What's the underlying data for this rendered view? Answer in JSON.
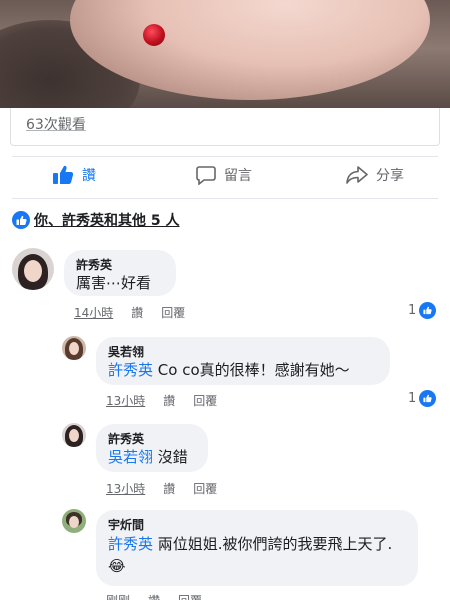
{
  "post": {
    "views": "63次觀看"
  },
  "actions": {
    "like": "讚",
    "comment": "留言",
    "share": "分享"
  },
  "reactions": {
    "summary": "你、許秀英和其他 5 人"
  },
  "comments": [
    {
      "author": "許秀英",
      "text": "厲害⋯好看",
      "time": "14小時",
      "like": "讚",
      "reply": "回覆",
      "likes": "1"
    },
    {
      "author": "吳若翎",
      "mention": "許秀英",
      "text": " Co co真的很棒！感謝有她～",
      "time": "13小時",
      "like": "讚",
      "reply": "回覆",
      "likes": "1"
    },
    {
      "author": "許秀英",
      "mention": "吳若翎",
      "text": " 沒錯",
      "time": "13小時",
      "like": "讚",
      "reply": "回覆"
    },
    {
      "author": "宇炘間",
      "mention": "許秀英",
      "text": " 兩位姐姐.被你們誇的我要飛上天了.😂",
      "time": "剛剛",
      "like": "讚",
      "reply": "回覆"
    }
  ]
}
